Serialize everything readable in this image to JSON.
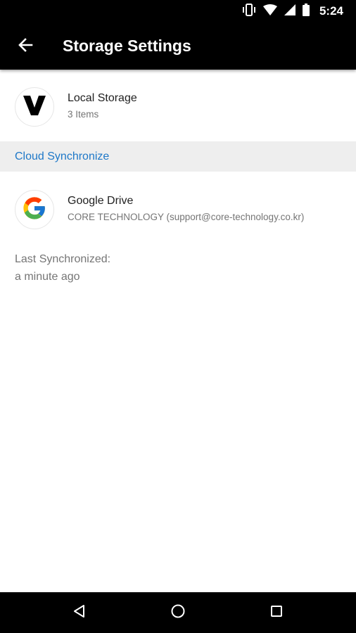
{
  "status_bar": {
    "time": "5:24",
    "icons": [
      "vibrate-icon",
      "wifi-icon",
      "cell-signal-icon",
      "battery-icon"
    ]
  },
  "app_bar": {
    "title": "Storage Settings",
    "back_icon": "arrow-back-icon"
  },
  "local_storage": {
    "icon": "v-logo-icon",
    "title": "Local Storage",
    "subtitle": "3 Items"
  },
  "cloud_section": {
    "header": "Cloud Synchronize",
    "header_color": "#1e78c8"
  },
  "google_drive": {
    "icon": "google-g-icon",
    "title": "Google Drive",
    "account": "CORE TECHNOLOGY (support@core-technology.co.kr)"
  },
  "sync_status": {
    "label": "Last Synchronized:",
    "value": "a minute ago"
  },
  "nav_bar": {
    "icons": [
      "nav-back-icon",
      "nav-home-icon",
      "nav-recents-icon"
    ]
  }
}
